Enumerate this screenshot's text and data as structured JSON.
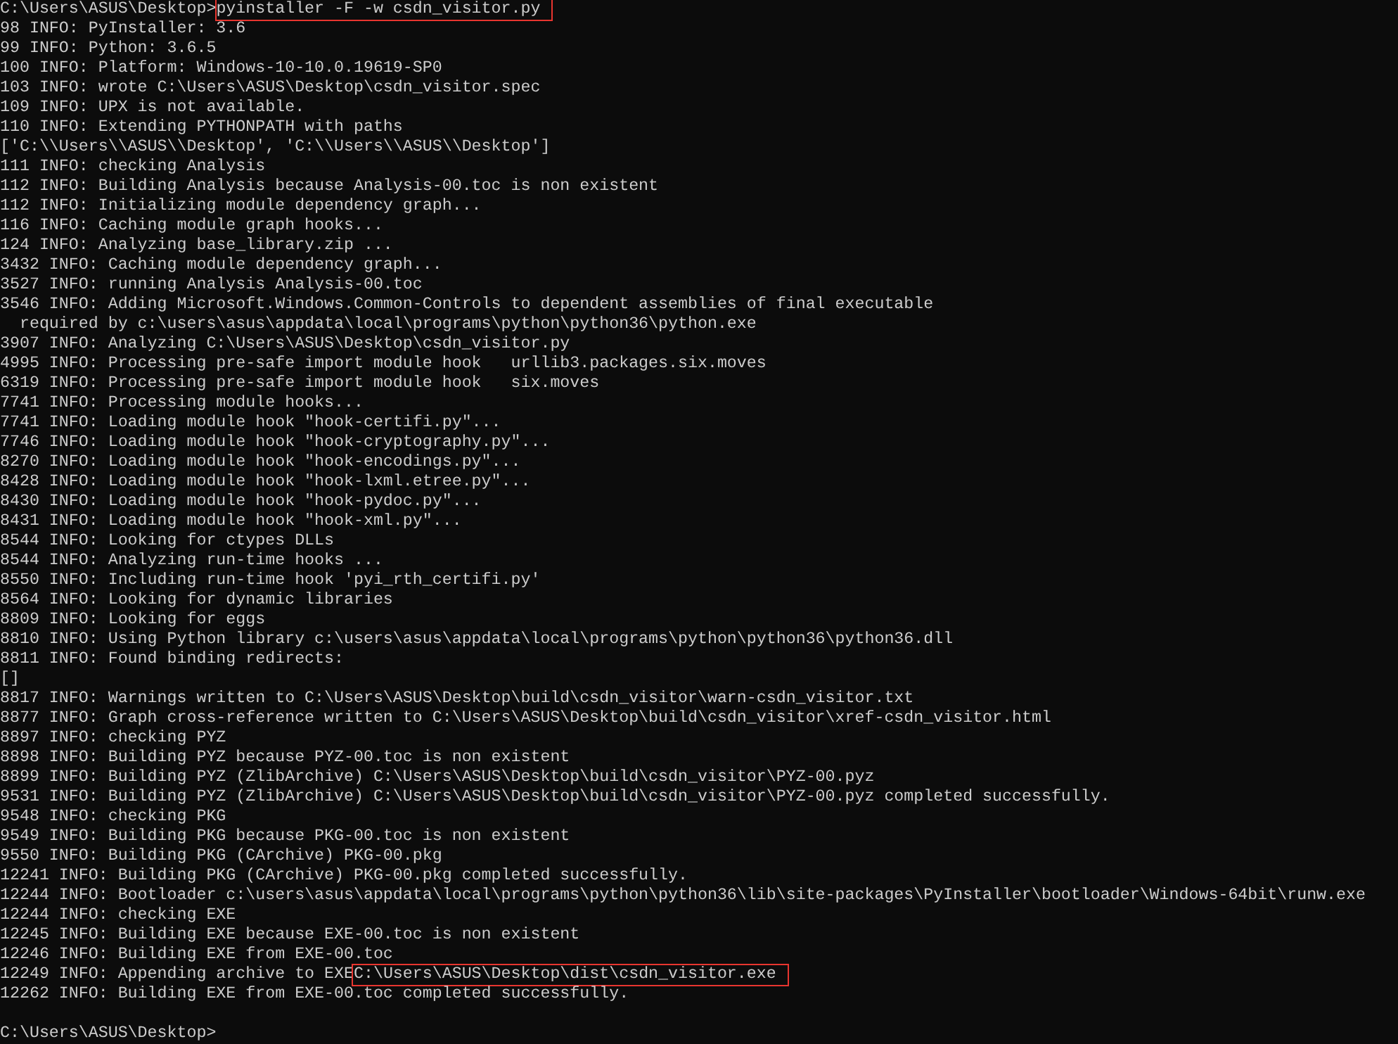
{
  "console": {
    "lines": [
      {
        "kind": "output",
        "text": "C:\\Users\\ASUS\\Desktop>",
        "highlight": "pyinstaller -F -w csdn_visitor.py"
      },
      {
        "kind": "output",
        "text": "98 INFO: PyInstaller: 3.6"
      },
      {
        "kind": "output",
        "text": "99 INFO: Python: 3.6.5"
      },
      {
        "kind": "output",
        "text": "100 INFO: Platform: Windows-10-10.0.19619-SP0"
      },
      {
        "kind": "output",
        "text": "103 INFO: wrote C:\\Users\\ASUS\\Desktop\\csdn_visitor.spec"
      },
      {
        "kind": "output",
        "text": "109 INFO: UPX is not available."
      },
      {
        "kind": "output",
        "text": "110 INFO: Extending PYTHONPATH with paths"
      },
      {
        "kind": "output",
        "text": "['C:\\\\Users\\\\ASUS\\\\Desktop', 'C:\\\\Users\\\\ASUS\\\\Desktop']"
      },
      {
        "kind": "output",
        "text": "111 INFO: checking Analysis"
      },
      {
        "kind": "output",
        "text": "112 INFO: Building Analysis because Analysis-00.toc is non existent"
      },
      {
        "kind": "output",
        "text": "112 INFO: Initializing module dependency graph..."
      },
      {
        "kind": "output",
        "text": "116 INFO: Caching module graph hooks..."
      },
      {
        "kind": "output",
        "text": "124 INFO: Analyzing base_library.zip ..."
      },
      {
        "kind": "output",
        "text": "3432 INFO: Caching module dependency graph..."
      },
      {
        "kind": "output",
        "text": "3527 INFO: running Analysis Analysis-00.toc"
      },
      {
        "kind": "output",
        "text": "3546 INFO: Adding Microsoft.Windows.Common-Controls to dependent assemblies of final executable"
      },
      {
        "kind": "output",
        "text": "  required by c:\\users\\asus\\appdata\\local\\programs\\python\\python36\\python.exe"
      },
      {
        "kind": "output",
        "text": "3907 INFO: Analyzing C:\\Users\\ASUS\\Desktop\\csdn_visitor.py"
      },
      {
        "kind": "output",
        "text": "4995 INFO: Processing pre-safe import module hook   urllib3.packages.six.moves"
      },
      {
        "kind": "output",
        "text": "6319 INFO: Processing pre-safe import module hook   six.moves"
      },
      {
        "kind": "output",
        "text": "7741 INFO: Processing module hooks..."
      },
      {
        "kind": "output",
        "text": "7741 INFO: Loading module hook \"hook-certifi.py\"..."
      },
      {
        "kind": "output",
        "text": "7746 INFO: Loading module hook \"hook-cryptography.py\"..."
      },
      {
        "kind": "output",
        "text": "8270 INFO: Loading module hook \"hook-encodings.py\"..."
      },
      {
        "kind": "output",
        "text": "8428 INFO: Loading module hook \"hook-lxml.etree.py\"..."
      },
      {
        "kind": "output",
        "text": "8430 INFO: Loading module hook \"hook-pydoc.py\"..."
      },
      {
        "kind": "output",
        "text": "8431 INFO: Loading module hook \"hook-xml.py\"..."
      },
      {
        "kind": "output",
        "text": "8544 INFO: Looking for ctypes DLLs"
      },
      {
        "kind": "output",
        "text": "8544 INFO: Analyzing run-time hooks ..."
      },
      {
        "kind": "output",
        "text": "8550 INFO: Including run-time hook 'pyi_rth_certifi.py'"
      },
      {
        "kind": "output",
        "text": "8564 INFO: Looking for dynamic libraries"
      },
      {
        "kind": "output",
        "text": "8809 INFO: Looking for eggs"
      },
      {
        "kind": "output",
        "text": "8810 INFO: Using Python library c:\\users\\asus\\appdata\\local\\programs\\python\\python36\\python36.dll"
      },
      {
        "kind": "output",
        "text": "8811 INFO: Found binding redirects:"
      },
      {
        "kind": "output",
        "text": "[]"
      },
      {
        "kind": "output",
        "text": "8817 INFO: Warnings written to C:\\Users\\ASUS\\Desktop\\build\\csdn_visitor\\warn-csdn_visitor.txt"
      },
      {
        "kind": "output",
        "text": "8877 INFO: Graph cross-reference written to C:\\Users\\ASUS\\Desktop\\build\\csdn_visitor\\xref-csdn_visitor.html"
      },
      {
        "kind": "output",
        "text": "8897 INFO: checking PYZ"
      },
      {
        "kind": "output",
        "text": "8898 INFO: Building PYZ because PYZ-00.toc is non existent"
      },
      {
        "kind": "output",
        "text": "8899 INFO: Building PYZ (ZlibArchive) C:\\Users\\ASUS\\Desktop\\build\\csdn_visitor\\PYZ-00.pyz"
      },
      {
        "kind": "output",
        "text": "9531 INFO: Building PYZ (ZlibArchive) C:\\Users\\ASUS\\Desktop\\build\\csdn_visitor\\PYZ-00.pyz completed successfully."
      },
      {
        "kind": "output",
        "text": "9548 INFO: checking PKG"
      },
      {
        "kind": "output",
        "text": "9549 INFO: Building PKG because PKG-00.toc is non existent"
      },
      {
        "kind": "output",
        "text": "9550 INFO: Building PKG (CArchive) PKG-00.pkg"
      },
      {
        "kind": "output",
        "text": "12241 INFO: Building PKG (CArchive) PKG-00.pkg completed successfully."
      },
      {
        "kind": "output",
        "text": "12244 INFO: Bootloader c:\\users\\asus\\appdata\\local\\programs\\python\\python36\\lib\\site-packages\\PyInstaller\\bootloader\\Windows-64bit\\runw.exe"
      },
      {
        "kind": "output",
        "text": "12244 INFO: checking EXE"
      },
      {
        "kind": "output",
        "text": "12245 INFO: Building EXE because EXE-00.toc is non existent"
      },
      {
        "kind": "output",
        "text": "12246 INFO: Building EXE from EXE-00.toc"
      },
      {
        "kind": "output",
        "text": "12249 INFO: Appending archive to EXE",
        "highlight": "C:\\Users\\ASUS\\Desktop\\dist\\csdn_visitor.exe"
      },
      {
        "kind": "output",
        "text": "12262 INFO: Building EXE from EXE-00.toc completed successfully."
      },
      {
        "kind": "blank"
      },
      {
        "kind": "output",
        "text": "C:\\Users\\ASUS\\Desktop>"
      }
    ]
  }
}
